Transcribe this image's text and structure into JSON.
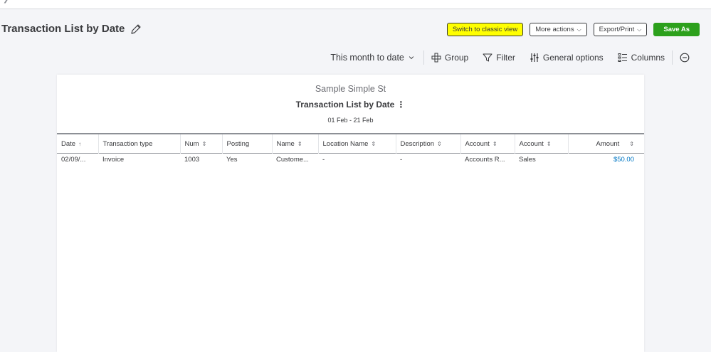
{
  "header": {
    "title": "Transaction List by Date",
    "buttons": {
      "classic": "Switch to classic view",
      "more": "More actions",
      "export": "Export/Print",
      "save": "Save As"
    }
  },
  "toolbar": {
    "date_range": "This month to date",
    "group": "Group",
    "filter": "Filter",
    "general": "General options",
    "columns": "Columns"
  },
  "report": {
    "company": "Sample Simple St",
    "title": "Transaction List by Date",
    "dates": "01 Feb - 21 Feb",
    "columns": [
      "Date",
      "Transaction type",
      "Num",
      "Posting",
      "Name",
      "Location Name",
      "Description",
      "Account",
      "Account",
      "Amount"
    ],
    "rows": [
      {
        "date": "02/09/...",
        "type": "Invoice",
        "num": "1003",
        "posting": "Yes",
        "name": "Custome...",
        "location": "-",
        "description": "-",
        "account1": "Accounts R...",
        "account2": "Sales",
        "amount": "$50.00"
      }
    ]
  },
  "colors": {
    "accent_green": "#2ca01c",
    "highlight_yellow": "#ffff00",
    "link_blue": "#0077c5"
  }
}
